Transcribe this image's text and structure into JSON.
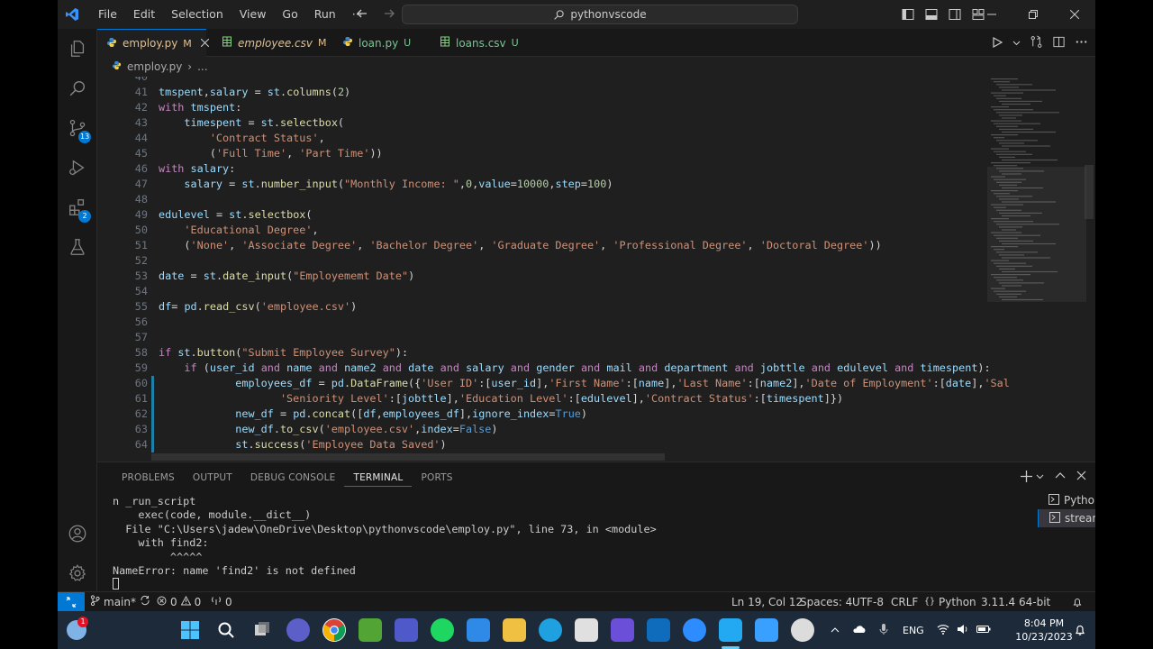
{
  "titlebar": {
    "menu": [
      "File",
      "Edit",
      "Selection",
      "View",
      "Go",
      "Run",
      "···"
    ],
    "search_text": "pythonvscode"
  },
  "activity": {
    "scm_badge": "13",
    "ext_badge": "2"
  },
  "tabs": [
    {
      "name": "employ.py",
      "mark": "M"
    },
    {
      "name": "employee.csv",
      "mark": "M"
    },
    {
      "name": "loan.py",
      "mark": "U"
    },
    {
      "name": "loans.csv",
      "mark": "U"
    }
  ],
  "breadcrumb": {
    "file": "employ.py",
    "more": "..."
  },
  "code": [
    {
      "n": "40",
      "t": ""
    },
    {
      "n": "41",
      "t": "tmspent,salary = st.columns(2)"
    },
    {
      "n": "42",
      "t": "with tmspent:"
    },
    {
      "n": "43",
      "t": "    timespent = st.selectbox("
    },
    {
      "n": "44",
      "t": "        'Contract Status',"
    },
    {
      "n": "45",
      "t": "        ('Full Time', 'Part Time'))"
    },
    {
      "n": "46",
      "t": "with salary:"
    },
    {
      "n": "47",
      "t": "    salary = st.number_input(\"Monthly Income: \",0,value=10000,step=100)"
    },
    {
      "n": "48",
      "t": ""
    },
    {
      "n": "49",
      "t": "edulevel = st.selectbox("
    },
    {
      "n": "50",
      "t": "    'Educational Degree',"
    },
    {
      "n": "51",
      "t": "    ('None', 'Associate Degree', 'Bachelor Degree', 'Graduate Degree', 'Professional Degree', 'Doctoral Degree'))"
    },
    {
      "n": "52",
      "t": ""
    },
    {
      "n": "53",
      "t": "date = st.date_input(\"Employememt Date\")"
    },
    {
      "n": "54",
      "t": ""
    },
    {
      "n": "55",
      "t": "df= pd.read_csv('employee.csv')"
    },
    {
      "n": "56",
      "t": ""
    },
    {
      "n": "57",
      "t": ""
    },
    {
      "n": "58",
      "t": "if st.button(\"Submit Employee Survey\"):"
    },
    {
      "n": "59",
      "t": "    if (user_id and name and name2 and date and salary and gender and mail and department and jobttle and edulevel and timespent):"
    },
    {
      "n": "60",
      "t": "            employees_df = pd.DataFrame({'User ID':[user_id],'First Name':[name],'Last Name':[name2],'Date of Employment':[date],'Sal"
    },
    {
      "n": "61",
      "t": "                   'Seniority Level':[jobttle],'Education Level':[edulevel],'Contract Status':[timespent]})"
    },
    {
      "n": "62",
      "t": "            new_df = pd.concat([df,employees_df],ignore_index=True)"
    },
    {
      "n": "63",
      "t": "            new_df.to_csv('employee.csv',index=False)"
    },
    {
      "n": "64",
      "t": "            st.success('Employee Data Saved')"
    }
  ],
  "panel": {
    "tabs": [
      "PROBLEMS",
      "OUTPUT",
      "DEBUG CONSOLE",
      "TERMINAL",
      "PORTS"
    ],
    "active_tab": "TERMINAL",
    "terminal_lines": [
      "n _run_script",
      "    exec(code, module.__dict__)",
      "  File \"C:\\Users\\jadew\\OneDrive\\Desktop\\pythonvscode\\employ.py\", line 73, in <module>",
      "    with find2:",
      "         ^^^^^",
      "NameError: name 'find2' is not defined"
    ],
    "terminals": [
      "Python",
      "streamlit"
    ]
  },
  "statusbar": {
    "branch": "main*",
    "errors": "0",
    "warnings": "0",
    "ports": "0",
    "position": "Ln 19, Col 12",
    "spaces": "Spaces: 4",
    "encoding": "UTF-8",
    "eol": "CRLF",
    "language": "Python",
    "interpreter": "3.11.4 64-bit"
  },
  "taskbar": {
    "lang": "ENG",
    "time": "8:04 PM",
    "date": "10/23/2023",
    "badge": "1"
  }
}
